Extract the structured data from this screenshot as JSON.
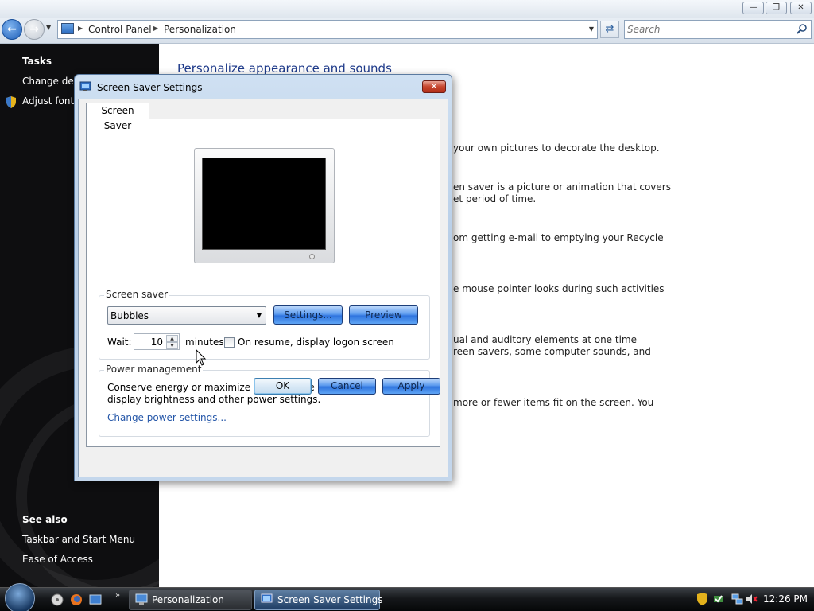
{
  "window": {
    "breadcrumb": [
      "Control Panel",
      "Personalization"
    ],
    "search_placeholder": "Search"
  },
  "taskpane": {
    "tasks_heading": "Tasks",
    "tasks": [
      "Change desk",
      "Adjust font s"
    ],
    "see_also_heading": "See also",
    "see_also": [
      "Taskbar and Start Menu",
      "Ease of Access"
    ]
  },
  "content": {
    "title": "Personalize appearance and sounds",
    "visible_fragments": [
      "your own pictures to decorate the desktop.",
      "en saver is a picture or animation that covers",
      "et period of time.",
      "om getting e-mail to emptying your Recycle",
      "e mouse pointer looks during such activities",
      "ual and auditory elements at one time",
      "reen savers, some computer sounds, and",
      "more or fewer items fit on the screen. You"
    ]
  },
  "dialog": {
    "title": "Screen Saver Settings",
    "tab_label": "Screen Saver",
    "screen_saver_group": {
      "label": "Screen saver",
      "selected_saver": "Bubbles",
      "settings_button": "Settings...",
      "preview_button": "Preview",
      "wait_label": "Wait:",
      "wait_value": "10",
      "minutes_label": "minutes",
      "resume_checkbox_label": "On resume, display logon screen",
      "resume_checked": false
    },
    "power_group": {
      "label": "Power management",
      "description": "Conserve energy or maximize performance by adjusting display brightness and other power settings.",
      "link": "Change power settings..."
    },
    "buttons": {
      "ok": "OK",
      "cancel": "Cancel",
      "apply": "Apply"
    }
  },
  "taskbar": {
    "tasks": [
      "Personalization",
      "Screen Saver Settings"
    ],
    "clock": "12:26 PM"
  },
  "colors": {
    "accent_blue": "#2f74de",
    "link_blue": "#2456a8",
    "taskpane_bg": "#0e0e10",
    "close_red": "#c6452d"
  }
}
